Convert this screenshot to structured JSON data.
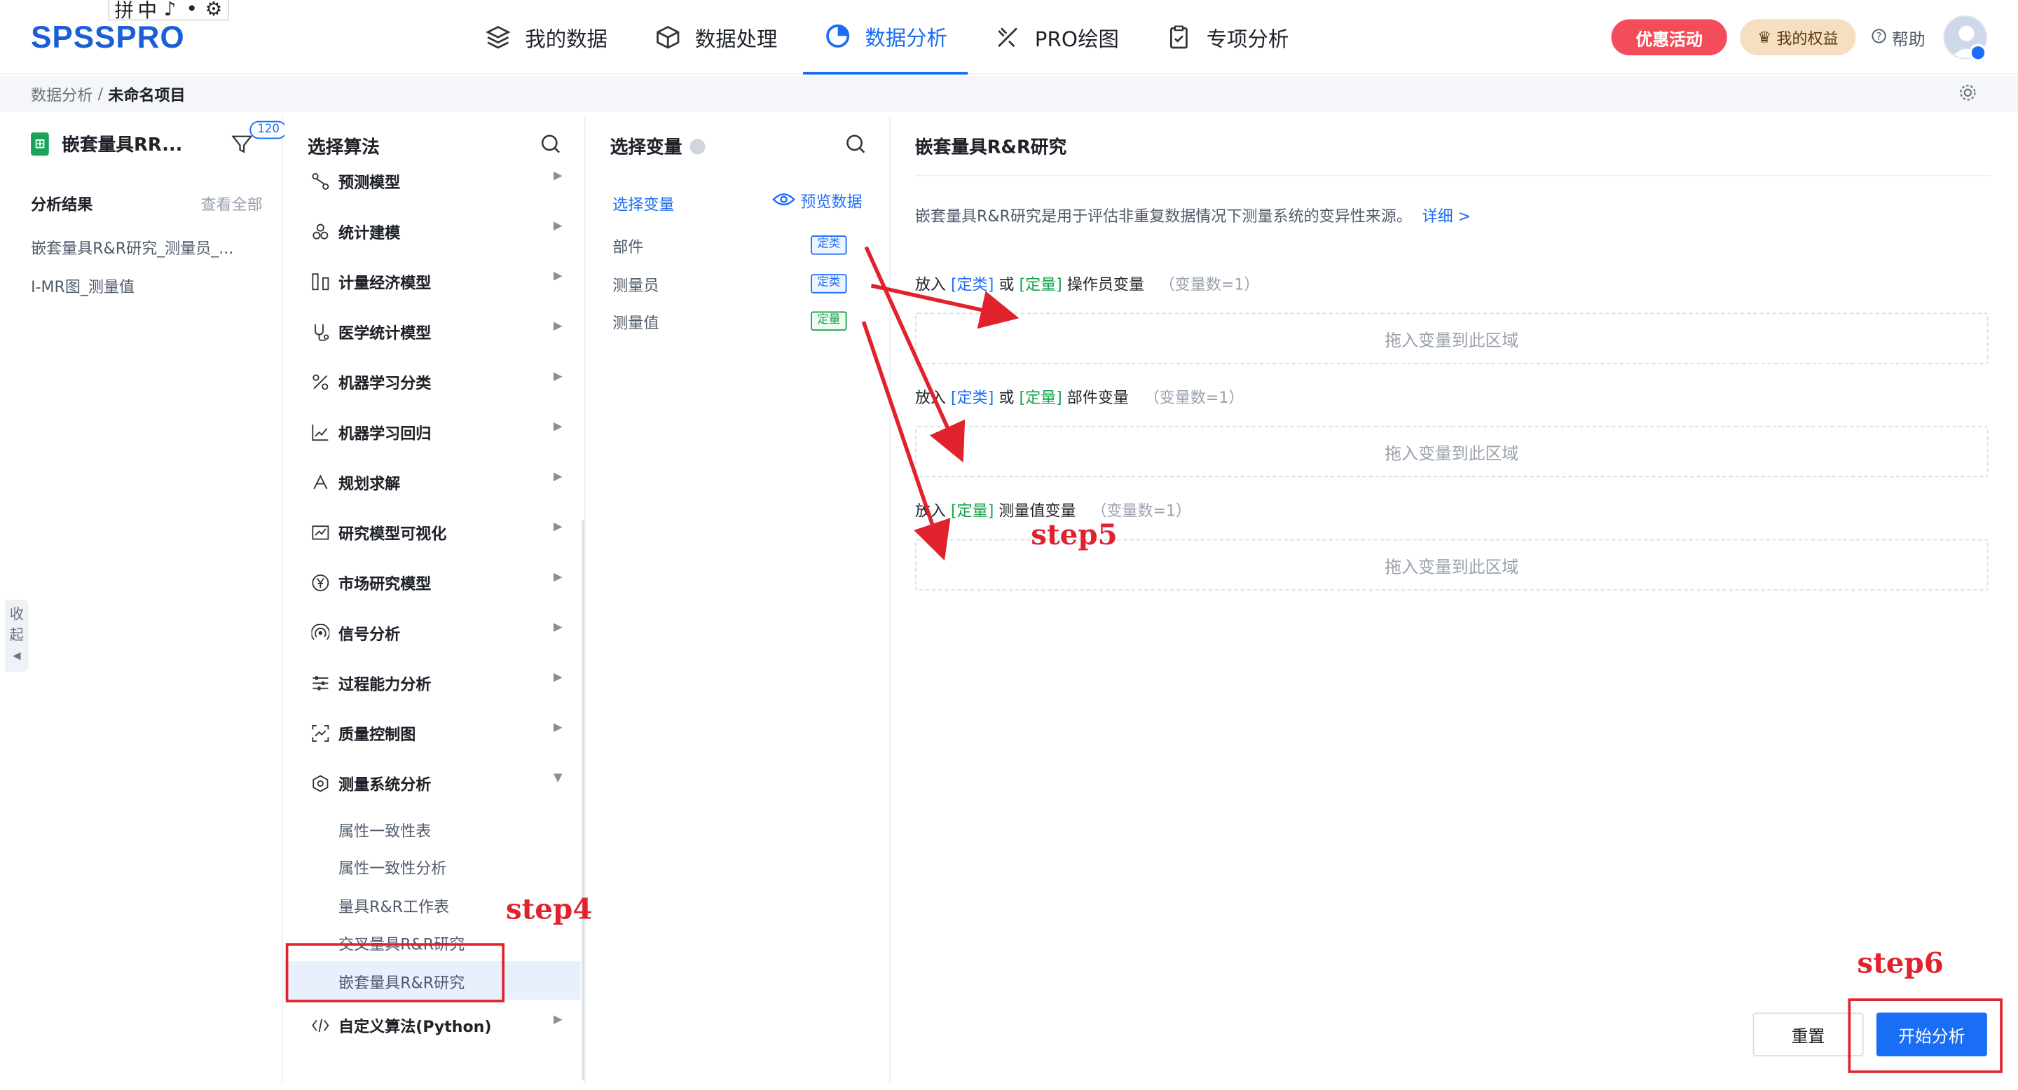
{
  "ime": {
    "items": [
      "拼",
      "中",
      "♪",
      "•",
      "⚙"
    ]
  },
  "logo": "SPSSPRO",
  "nav": {
    "items": [
      {
        "label": "我的数据",
        "icon": "layers-icon"
      },
      {
        "label": "数据处理",
        "icon": "cube-icon"
      },
      {
        "label": "数据分析",
        "icon": "pie-chart-icon",
        "active": true
      },
      {
        "label": "PRO绘图",
        "icon": "draw-tools-icon"
      },
      {
        "label": "专项分析",
        "icon": "clipboard-icon"
      }
    ],
    "promo": "优惠活动",
    "rights": "我的权益",
    "help": "帮助"
  },
  "breadcrumb": {
    "parent": "数据分析",
    "separator": "/",
    "current": "未命名项目"
  },
  "left": {
    "project_title": "嵌套量具RR...",
    "filter_count": "120",
    "results_title": "分析结果",
    "view_all": "查看全部",
    "results": [
      "嵌套量具R&R研究_测量员_...",
      "I-MR图_测量值"
    ],
    "collapse": [
      "收",
      "起",
      "◀"
    ]
  },
  "algorithms": {
    "title": "选择算法",
    "items": [
      {
        "label": "预测模型",
        "icon": "flow-icon"
      },
      {
        "label": "统计建模",
        "icon": "clusters-icon"
      },
      {
        "label": "计量经济模型",
        "icon": "bars-icon"
      },
      {
        "label": "医学统计模型",
        "icon": "stethoscope-icon"
      },
      {
        "label": "机器学习分类",
        "icon": "percent-icon"
      },
      {
        "label": "机器学习回归",
        "icon": "regression-icon"
      },
      {
        "label": "规划求解",
        "icon": "planning-icon"
      },
      {
        "label": "研究模型可视化",
        "icon": "line-chart-icon"
      },
      {
        "label": "市场研究模型",
        "icon": "yen-icon"
      },
      {
        "label": "信号分析",
        "icon": "signal-icon"
      },
      {
        "label": "过程能力分析",
        "icon": "sliders-icon"
      },
      {
        "label": "质量控制图",
        "icon": "scan-icon"
      },
      {
        "label": "测量系统分析",
        "icon": "shield-gear-icon",
        "expanded": true
      },
      {
        "label": "自定义算法(Python)",
        "icon": "code-icon"
      }
    ],
    "sub_items": [
      "属性一致性表",
      "属性一致性分析",
      "量具R&R工作表",
      "交叉量具R&R研究",
      "嵌套量具R&R研究"
    ],
    "selected_sub": "嵌套量具R&R研究"
  },
  "variables": {
    "title": "选择变量",
    "sub_title": "选择变量",
    "preview": "预览数据",
    "items": [
      {
        "name": "部件",
        "type": "定类",
        "kind": "cat"
      },
      {
        "name": "测量员",
        "type": "定类",
        "kind": "cat"
      },
      {
        "name": "测量值",
        "type": "定量",
        "kind": "num"
      }
    ]
  },
  "main": {
    "title": "嵌套量具R&R研究",
    "description": "嵌套量具R&R研究是用于评估非重复数据情况下测量系统的变异性来源。",
    "detail_link": "详细 >",
    "slots": [
      {
        "prefix": "放入",
        "tag1": "[定类]",
        "or": "或",
        "tag2": "[定量]",
        "name": "操作员变量",
        "count": "（变量数=1）",
        "drop": "拖入变量到此区域"
      },
      {
        "prefix": "放入",
        "tag1": "[定类]",
        "or": "或",
        "tag2": "[定量]",
        "name": "部件变量",
        "count": "（变量数=1）",
        "drop": "拖入变量到此区域"
      },
      {
        "prefix": "放入",
        "tag2": "[定量]",
        "name": "测量值变量",
        "count": "（变量数=1）",
        "drop": "拖入变量到此区域"
      }
    ],
    "reset": "重置",
    "start": "开始分析"
  },
  "annotations": {
    "step4": "step4",
    "step5": "step5",
    "step6": "step6"
  },
  "colors": {
    "primary": "#1a6df5",
    "annotation": "#e0222c",
    "promo": "#f34c5a",
    "numeric_tag": "#16a34a"
  }
}
